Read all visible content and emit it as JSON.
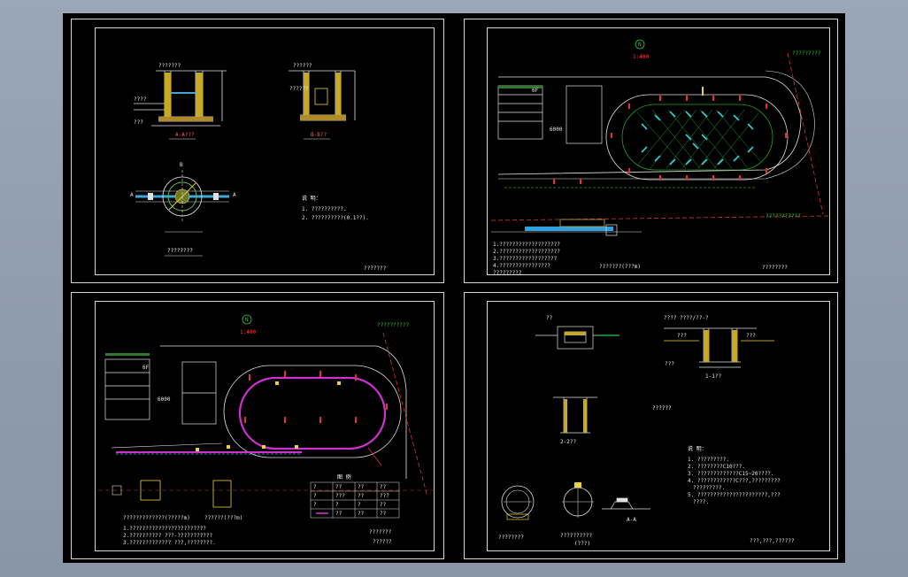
{
  "sheets": [
    {
      "id": "detail-sections",
      "labels": {
        "section_a": "A-A???",
        "section_b": "B-B??",
        "plan_caption": "????????",
        "notes_title": "说 明：",
        "note_1": "1. ??????????.",
        "note_2": "2. ??????????(0.1??).",
        "title_block": "???????",
        "dim_a": "???????",
        "dim_b": "??????",
        "level_mark": "????",
        "marker_b": "B",
        "marker_a_left": "A",
        "marker_a_right": "A",
        "gate_label": "??????",
        "pipe_label": "???"
      }
    },
    {
      "id": "site-plan-irrigation",
      "labels": {
        "north": "N",
        "scale": "1:400",
        "building": "6F",
        "road_label_top": "?????????",
        "road_label_bottom": "???????????",
        "legend_1": "1.???????????????????",
        "legend_2": "2.???????????????????",
        "legend_3": "3.??????????????????",
        "legend_4": "4.????????????????",
        "legend_5": "?????????",
        "section_label": "???????(???m)",
        "title_block": "????????",
        "dim_6000": "6000"
      }
    },
    {
      "id": "site-plan-drainage",
      "labels": {
        "north": "N",
        "scale": "1:400",
        "building": "6F",
        "road_label": "??????????",
        "dim_6000": "6000",
        "legend_title": "图 例",
        "detail_1": "?????????????(?????m)",
        "detail_2": "??????(???m)",
        "note_1": "1.????????????????????????",
        "note_2": "2.??????????  ???-???????????",
        "note_3": "3.?????????????  ???,????????.",
        "title_block_1": "???????",
        "title_block_2": "??????"
      },
      "legend_rows": [
        [
          "?",
          "??",
          "??",
          "??"
        ],
        [
          "?",
          "???",
          "??",
          "???"
        ],
        [
          "?",
          "?",
          "?",
          "??"
        ],
        [
          "?",
          "??",
          "??",
          "??"
        ]
      ]
    },
    {
      "id": "manhole-details",
      "labels": {
        "detail_top_left": "??",
        "detail_top_right": "???? ????/??-?",
        "label_a": "???",
        "label_b": "???",
        "label_c": "???",
        "section_caption": "??????",
        "section_1": "1-1??",
        "section_2": "2-2??",
        "notes_title": "说 明：",
        "note_1": "1. ?????????.",
        "note_2": "2. ????????C10???.",
        "note_3": "3. ?????????????C15~20????.",
        "note_4": "4. ????????????C???,?????????",
        "note_5": "?????????.",
        "note_6": "5. ??????????????????????,???",
        "note_7": "????.",
        "caption_left": "????????",
        "caption_right": "??????????",
        "caption_right_sub": "(???)",
        "caption_aa": "A-A",
        "title_block": "???,???,??????"
      }
    }
  ]
}
